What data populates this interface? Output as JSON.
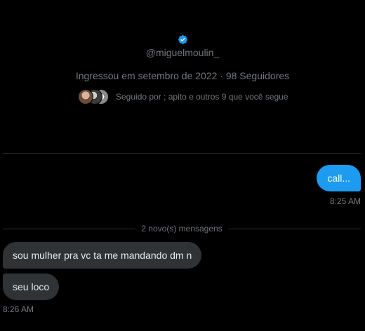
{
  "profile": {
    "handle": "@miguelmoulin_",
    "joined": "Ingressou em setembro de 2022 · 98 Seguidores",
    "followed_by": "Seguido por ; apito e outros 9 que você segue",
    "verified_icon": "verified-badge-icon"
  },
  "conversation": {
    "outgoing": [
      {
        "text": "call...",
        "time": "8:25 AM"
      }
    ],
    "new_messages_label": "2 novo(s) mensagens",
    "incoming": [
      {
        "text": "sou mulher pra vc ta me mandando dm n"
      },
      {
        "text": "seu loco"
      }
    ],
    "incoming_time": "8:26 AM"
  },
  "colors": {
    "background": "#000000",
    "accent": "#1d9bf0",
    "secondary_text": "#71767b",
    "incoming_bubble": "#2f3336"
  }
}
